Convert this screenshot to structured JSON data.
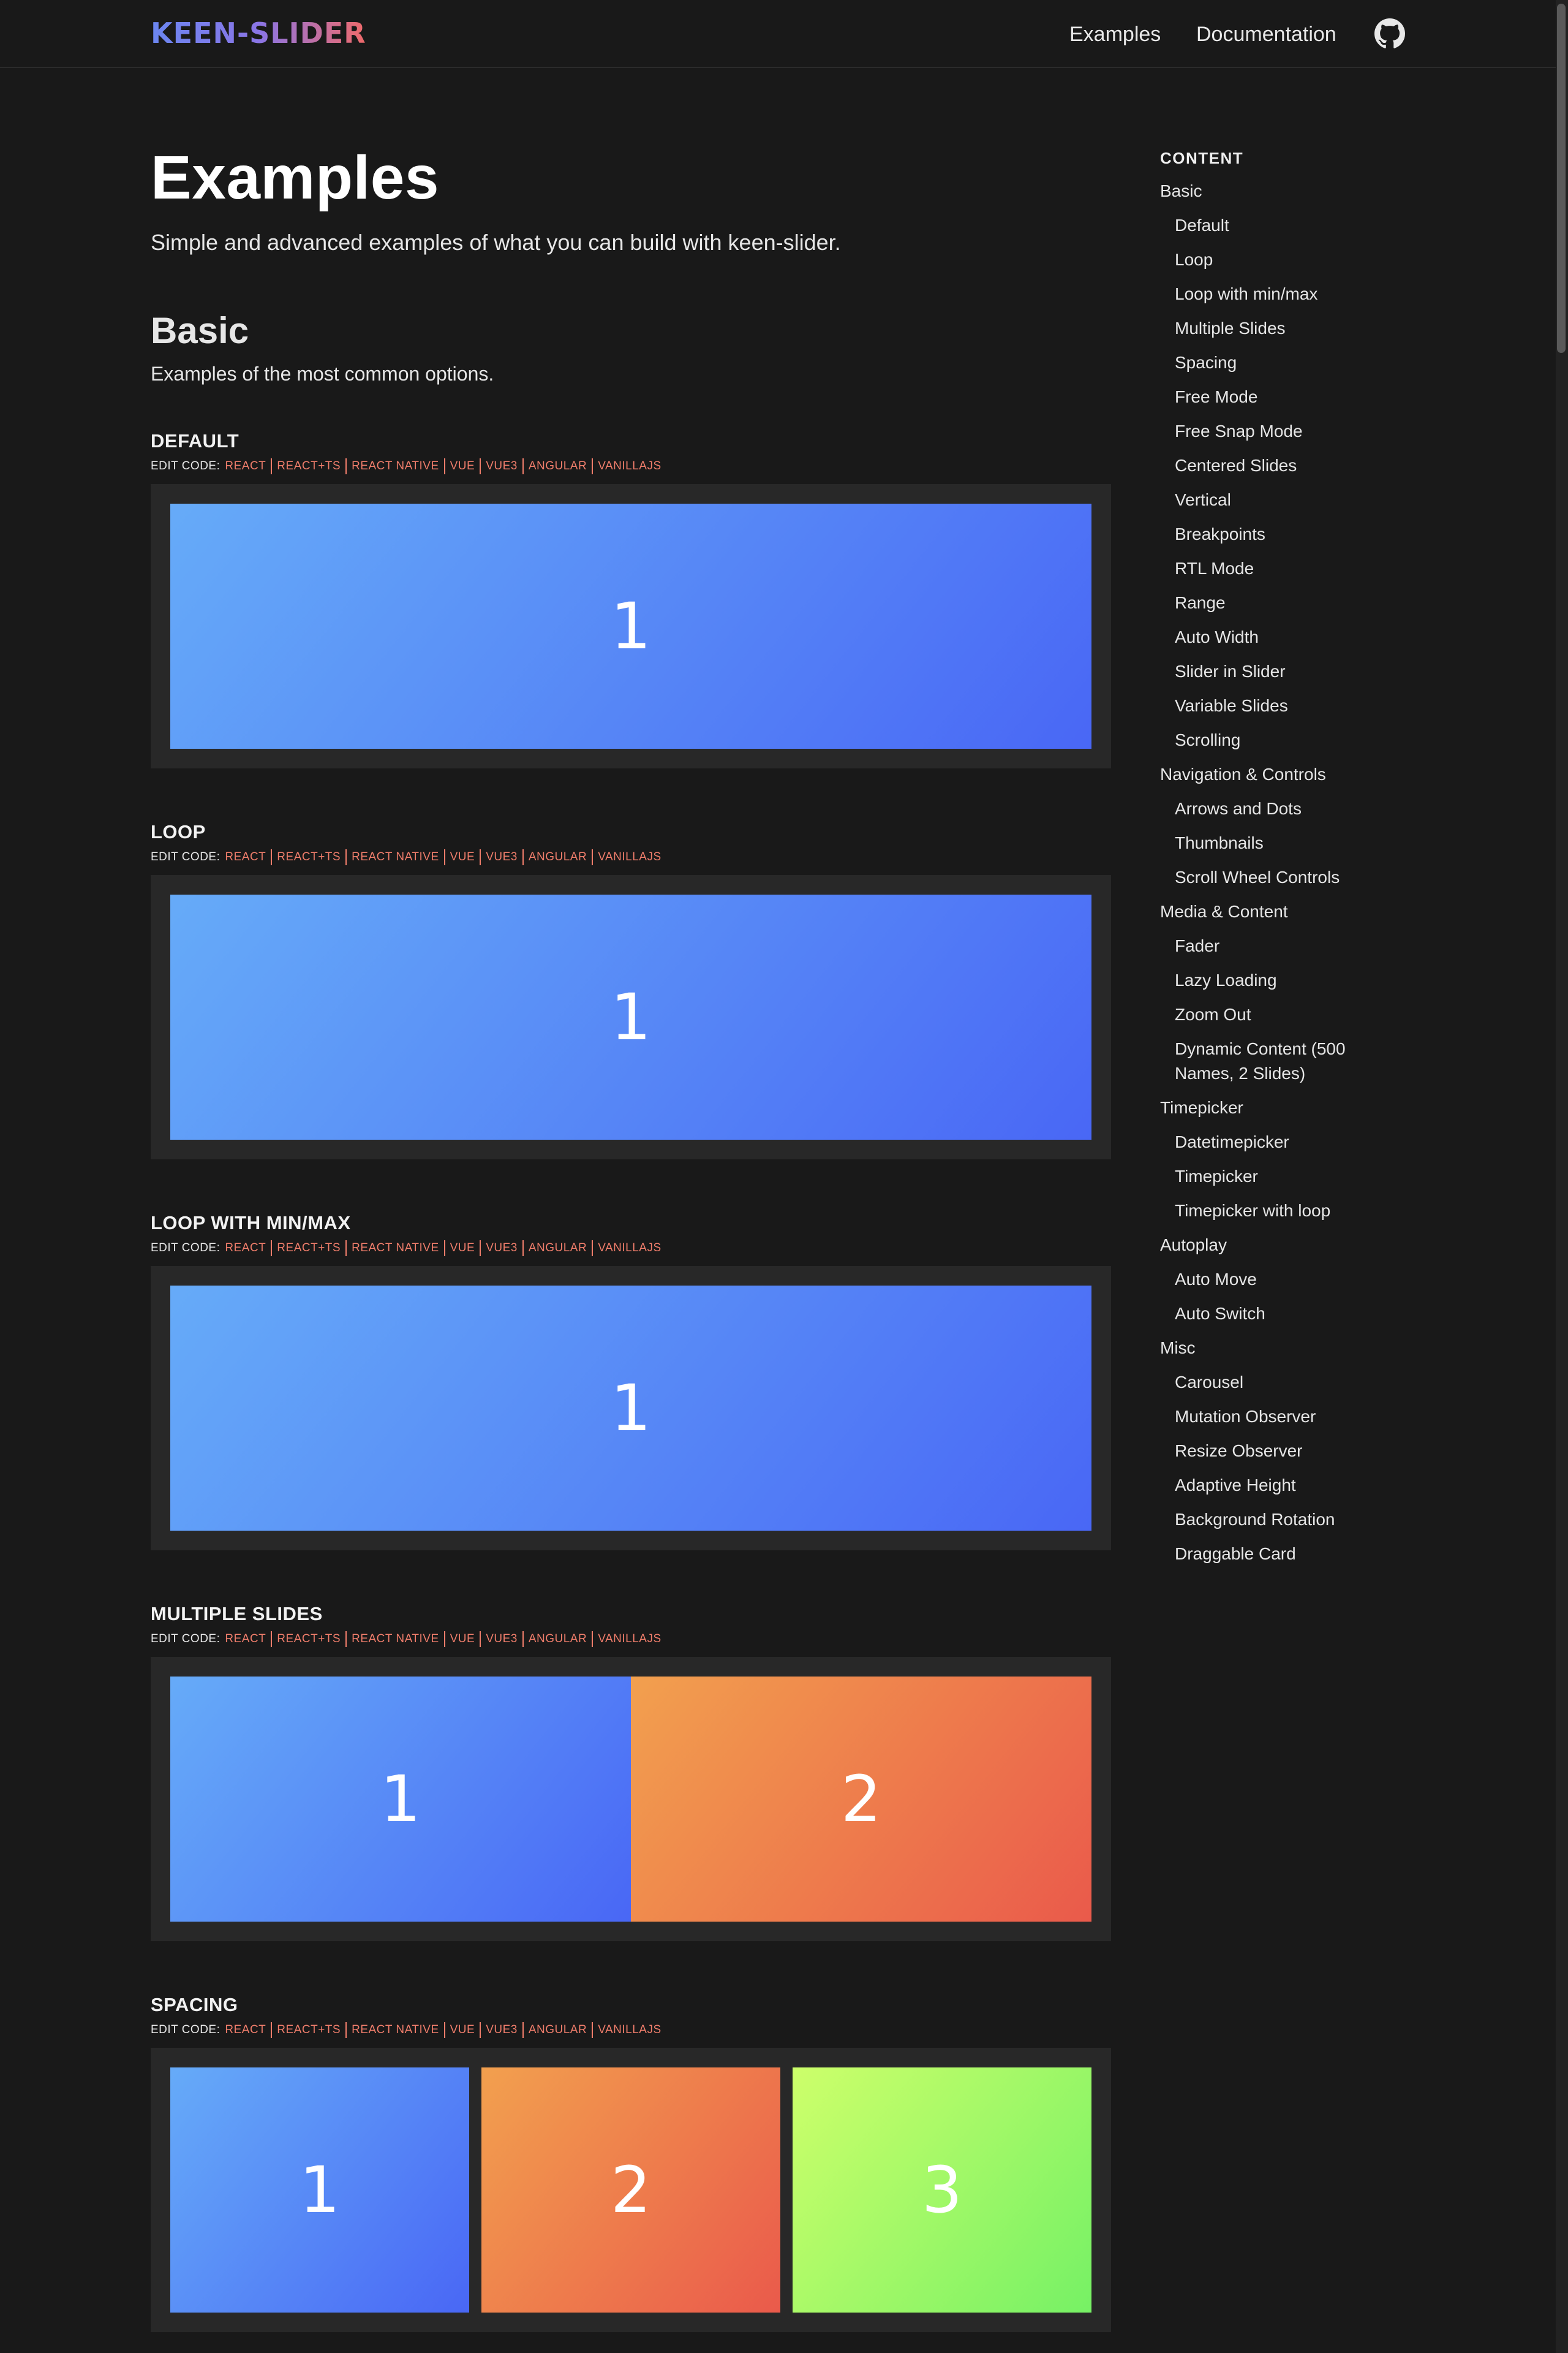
{
  "header": {
    "logo": "KEEN-SLIDER",
    "nav": [
      "Examples",
      "Documentation"
    ],
    "github_icon": "github-icon"
  },
  "page": {
    "title": "Examples",
    "subtitle": "Simple and advanced examples of what you can build with keen-slider."
  },
  "section": {
    "title": "Basic",
    "subtitle": "Examples of the most common options."
  },
  "edit_label": "EDIT CODE:",
  "edit_links": [
    "REACT",
    "REACT+TS",
    "REACT NATIVE",
    "VUE",
    "VUE3",
    "ANGULAR",
    "VANILLAJS"
  ],
  "examples": [
    {
      "title": "DEFAULT",
      "slides": [
        "1"
      ]
    },
    {
      "title": "LOOP",
      "slides": [
        "1"
      ]
    },
    {
      "title": "LOOP WITH MIN/MAX",
      "slides": [
        "1"
      ]
    },
    {
      "title": "MULTIPLE SLIDES",
      "slides": [
        "1",
        "2"
      ]
    },
    {
      "title": "SPACING",
      "slides": [
        "1",
        "2",
        "3"
      ]
    }
  ],
  "colors": {
    "background": "#191919",
    "frame": "#282828",
    "link": "#ef7d6b",
    "slide_blue": [
      "#66abf8",
      "#4967f5"
    ],
    "slide_orange": [
      "#f2a04e",
      "#ea5a4b"
    ],
    "slide_green": [
      "#cdff6a",
      "#76f165"
    ]
  },
  "toc": {
    "heading": "CONTENT",
    "items": [
      {
        "label": "Basic",
        "level": 0
      },
      {
        "label": "Default",
        "level": 1
      },
      {
        "label": "Loop",
        "level": 1
      },
      {
        "label": "Loop with min/max",
        "level": 1
      },
      {
        "label": "Multiple Slides",
        "level": 1
      },
      {
        "label": "Spacing",
        "level": 1
      },
      {
        "label": "Free Mode",
        "level": 1
      },
      {
        "label": "Free Snap Mode",
        "level": 1
      },
      {
        "label": "Centered Slides",
        "level": 1
      },
      {
        "label": "Vertical",
        "level": 1
      },
      {
        "label": "Breakpoints",
        "level": 1
      },
      {
        "label": "RTL Mode",
        "level": 1
      },
      {
        "label": "Range",
        "level": 1
      },
      {
        "label": "Auto Width",
        "level": 1
      },
      {
        "label": "Slider in Slider",
        "level": 1
      },
      {
        "label": "Variable Slides",
        "level": 1
      },
      {
        "label": "Scrolling",
        "level": 1
      },
      {
        "label": "Navigation & Controls",
        "level": 0
      },
      {
        "label": "Arrows and Dots",
        "level": 1
      },
      {
        "label": "Thumbnails",
        "level": 1
      },
      {
        "label": "Scroll Wheel Controls",
        "level": 1
      },
      {
        "label": "Media & Content",
        "level": 0
      },
      {
        "label": "Fader",
        "level": 1
      },
      {
        "label": "Lazy Loading",
        "level": 1
      },
      {
        "label": "Zoom Out",
        "level": 1
      },
      {
        "label": "Dynamic Content (500 Names, 2 Slides)",
        "level": 1
      },
      {
        "label": "Timepicker",
        "level": 0
      },
      {
        "label": "Datetimepicker",
        "level": 1
      },
      {
        "label": "Timepicker",
        "level": 1
      },
      {
        "label": "Timepicker with loop",
        "level": 1
      },
      {
        "label": "Autoplay",
        "level": 0
      },
      {
        "label": "Auto Move",
        "level": 1
      },
      {
        "label": "Auto Switch",
        "level": 1
      },
      {
        "label": "Misc",
        "level": 0
      },
      {
        "label": "Carousel",
        "level": 1
      },
      {
        "label": "Mutation Observer",
        "level": 1
      },
      {
        "label": "Resize Observer",
        "level": 1
      },
      {
        "label": "Adaptive Height",
        "level": 1
      },
      {
        "label": "Background Rotation",
        "level": 1
      },
      {
        "label": "Draggable Card",
        "level": 1
      }
    ]
  }
}
